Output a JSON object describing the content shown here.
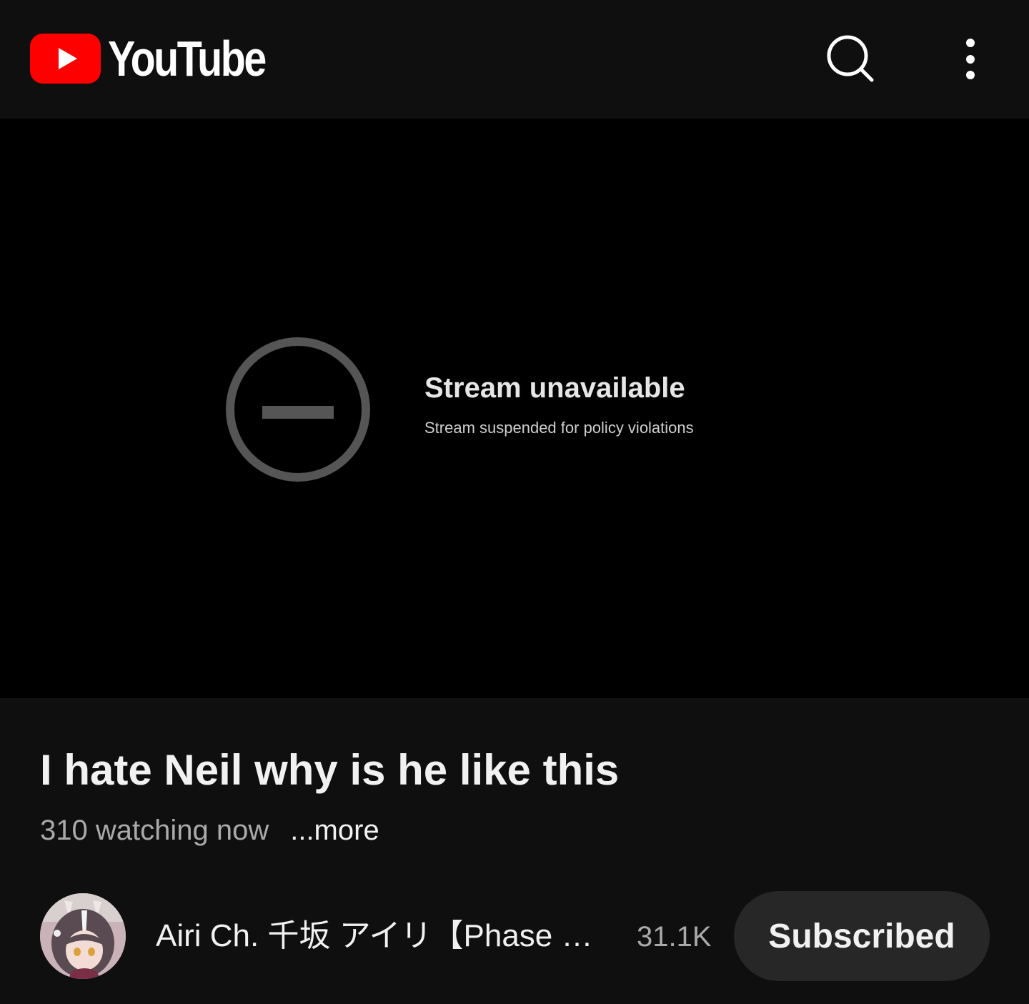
{
  "header": {
    "logo_text": "YouTube",
    "logo_icon": "youtube-play-icon",
    "search_icon": "search-icon",
    "more_icon": "more-vert-icon",
    "brand_color": "#ff0000"
  },
  "player": {
    "status_icon": "blocked-circle-icon",
    "status_title": "Stream unavailable",
    "status_message": "Stream suspended for policy violations"
  },
  "video": {
    "title": "I hate Neil why is he like this",
    "watching": "310 watching now",
    "more_label": "...more"
  },
  "channel": {
    "name": "Airi Ch. 千坂 アイリ【Phase Connect】",
    "subscriber_count": "31.1K",
    "subscribe_label": "Subscribed"
  }
}
